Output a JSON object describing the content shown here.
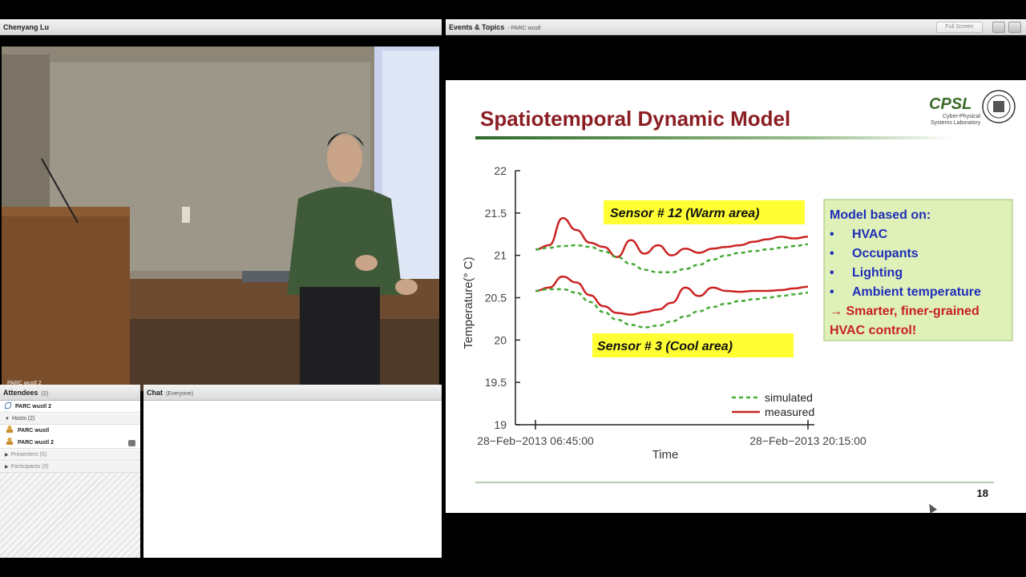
{
  "video": {
    "title": "Chenyang Lu",
    "feed_label": "PARC wustl 2"
  },
  "events": {
    "title": "Events & Topics",
    "subtitle": "- PARC wustl",
    "fullscreen_label": "Full Screen"
  },
  "slide": {
    "title": "Spatiotemporal Dynamic Model",
    "logo_text": "CPSL",
    "logo_sub1": "Cyber-Physical",
    "logo_sub2": "Systems Laboratory",
    "page_number": "18",
    "callout_warm": "Sensor # 12 (Warm area)",
    "callout_cool": "Sensor # 3 (Cool area)",
    "model_box": {
      "heading": "Model based on:",
      "bullets": [
        "HVAC",
        "Occupants",
        "Lighting",
        "Ambient temperature"
      ],
      "conclusion_line1": "→ Smarter, finer-grained",
      "conclusion_line2": "HVAC control!"
    }
  },
  "chart_data": {
    "type": "line",
    "xlabel": "Time",
    "ylabel": "Temperature(° C)",
    "ylim": [
      19,
      22
    ],
    "yticks": [
      "22",
      "21.5",
      "21",
      "20.5",
      "20",
      "19.5",
      "19"
    ],
    "xticks": [
      "28−Feb−2013 06:45:00",
      "28−Feb−2013 20:15:00"
    ],
    "x": [
      0,
      0.05,
      0.1,
      0.15,
      0.2,
      0.25,
      0.3,
      0.35,
      0.4,
      0.45,
      0.5,
      0.55,
      0.6,
      0.65,
      0.7,
      0.75,
      0.8,
      0.85,
      0.9,
      0.95,
      1.0
    ],
    "legend": [
      "simulated",
      "measured"
    ],
    "series": [
      {
        "name": "measured",
        "sensor": "12",
        "color": "#cc2222",
        "style": "solid",
        "values": [
          21.07,
          21.12,
          21.44,
          21.3,
          21.15,
          21.1,
          20.98,
          21.18,
          21.02,
          21.12,
          21.0,
          21.08,
          21.03,
          21.08,
          21.1,
          21.12,
          21.16,
          21.19,
          21.22,
          21.2,
          21.22
        ]
      },
      {
        "name": "simulated",
        "sensor": "12",
        "color": "#44aa33",
        "style": "dashed",
        "values": [
          21.07,
          21.09,
          21.11,
          21.12,
          21.1,
          21.05,
          20.98,
          20.9,
          20.83,
          20.8,
          20.8,
          20.84,
          20.89,
          20.95,
          21.0,
          21.03,
          21.05,
          21.07,
          21.09,
          21.11,
          21.13
        ]
      },
      {
        "name": "measured",
        "sensor": "3",
        "color": "#cc2222",
        "style": "solid",
        "values": [
          20.58,
          20.62,
          20.75,
          20.68,
          20.53,
          20.4,
          20.32,
          20.3,
          20.33,
          20.36,
          20.44,
          20.62,
          20.52,
          20.62,
          20.58,
          20.57,
          20.58,
          20.58,
          20.59,
          20.61,
          20.63
        ]
      },
      {
        "name": "simulated",
        "sensor": "3",
        "color": "#44aa33",
        "style": "dashed",
        "values": [
          20.58,
          20.6,
          20.6,
          20.56,
          20.45,
          20.33,
          20.24,
          20.18,
          20.15,
          20.17,
          20.22,
          20.28,
          20.34,
          20.39,
          20.43,
          20.46,
          20.48,
          20.5,
          20.52,
          20.54,
          20.56
        ]
      }
    ]
  },
  "attendees": {
    "title": "Attendees",
    "count": "(2)",
    "me": "PARC wustl 2",
    "hosts_label": "Hosts (2)",
    "hosts": [
      "PARC wustl",
      "PARC wustl 2"
    ],
    "presenters_label": "Presenters (0)",
    "participants_label": "Participants (0)"
  },
  "chat": {
    "title": "Chat",
    "scope": "(Everyone)"
  }
}
